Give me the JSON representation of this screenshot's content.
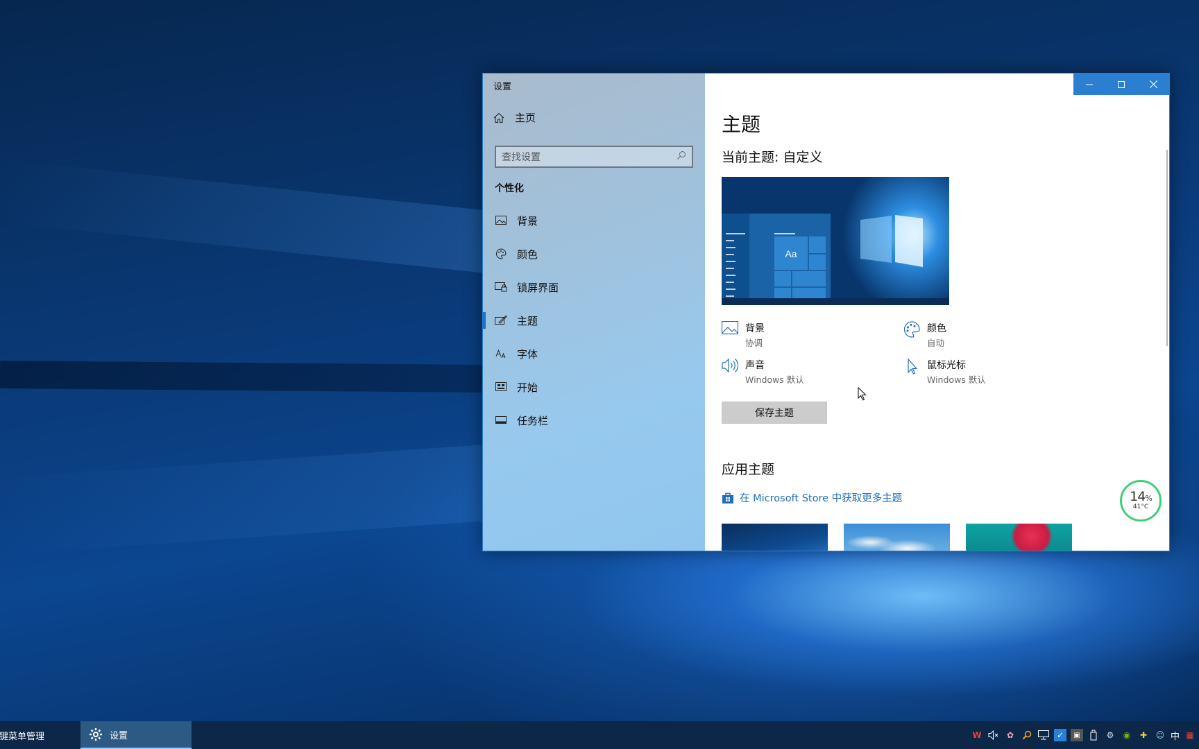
{
  "window": {
    "title": "设置",
    "controls": {
      "minimize": "minimize-icon",
      "maximize": "maximize-icon",
      "close": "close-icon"
    }
  },
  "sidebar": {
    "home_label": "主页",
    "search_placeholder": "查找设置",
    "section_title": "个性化",
    "items": [
      {
        "label": "背景",
        "icon": "picture-icon"
      },
      {
        "label": "颜色",
        "icon": "palette-icon"
      },
      {
        "label": "锁屏界面",
        "icon": "lock-screen-icon"
      },
      {
        "label": "主题",
        "icon": "theme-brush-icon",
        "active": true
      },
      {
        "label": "字体",
        "icon": "font-icon"
      },
      {
        "label": "开始",
        "icon": "start-icon"
      },
      {
        "label": "任务栏",
        "icon": "taskbar-icon"
      }
    ]
  },
  "main": {
    "title": "主题",
    "current_theme": "当前主题: 自定义",
    "preview_sample_text": "Aa",
    "properties": {
      "background": {
        "name": "背景",
        "value": "协调"
      },
      "color": {
        "name": "颜色",
        "value": "自动"
      },
      "sound": {
        "name": "声音",
        "value": "Windows 默认"
      },
      "cursor": {
        "name": "鼠标光标",
        "value": "Windows 默认"
      }
    },
    "save_button": "保存主题",
    "apply_title": "应用主题",
    "store_link": "在 Microsoft Store 中获取更多主题"
  },
  "perf_widget": {
    "percent": "14",
    "percent_unit": "%",
    "temperature": "41°C"
  },
  "taskbar": {
    "app1_label": "右键菜单管理",
    "app2_label": "设置",
    "ime": "中"
  },
  "colors": {
    "accent": "#2b7fd0",
    "link": "#1f6fb8",
    "taskbar": "#0c2747",
    "perf_ring": "#3fcf75"
  }
}
